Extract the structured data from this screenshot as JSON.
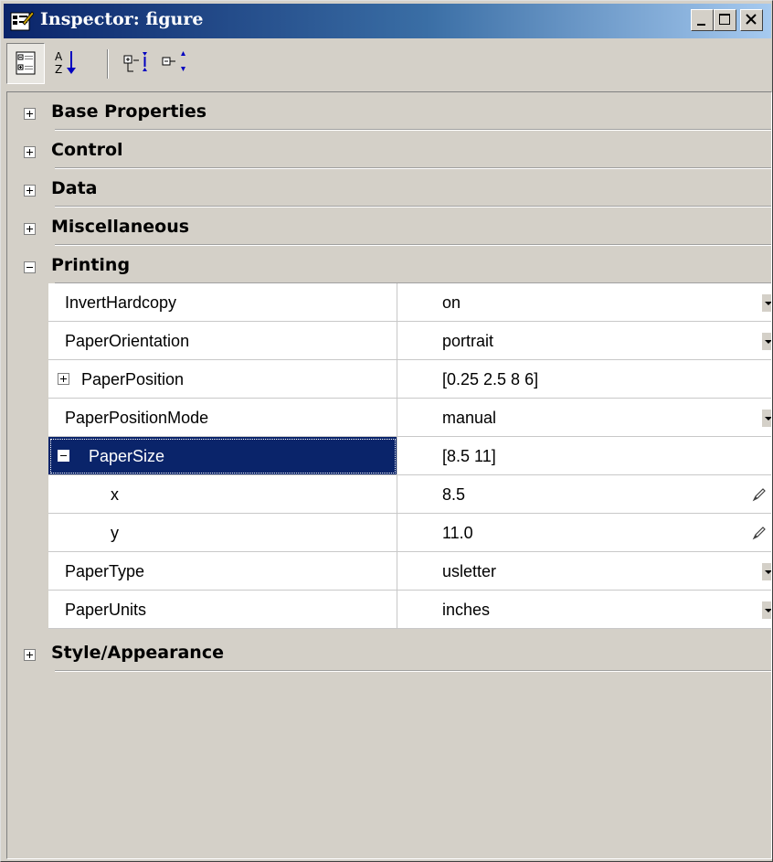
{
  "window": {
    "title": "Inspector: figure"
  },
  "toolbar": {
    "buttons": [
      "categorized-view",
      "alphabetical-sort",
      "expand-all",
      "collapse-all"
    ]
  },
  "categories": [
    {
      "label": "Base Properties",
      "expanded": false
    },
    {
      "label": "Control",
      "expanded": false
    },
    {
      "label": "Data",
      "expanded": false
    },
    {
      "label": "Miscellaneous",
      "expanded": false
    },
    {
      "label": "Printing",
      "expanded": true
    },
    {
      "label": "Style/Appearance",
      "expanded": false
    }
  ],
  "properties": [
    {
      "name": "InvertHardcopy",
      "value": "on",
      "editor": "dropdown"
    },
    {
      "name": "PaperOrientation",
      "value": "portrait",
      "editor": "dropdown"
    },
    {
      "name": "PaperPosition",
      "value": "[0.25 2.5 8 6]",
      "editor": "none",
      "expander": "plus"
    },
    {
      "name": "PaperPositionMode",
      "value": "manual",
      "editor": "dropdown"
    },
    {
      "name": "PaperSize",
      "value": "[8.5 11]",
      "editor": "none",
      "expander": "minus",
      "selected": true
    },
    {
      "name": "x",
      "value": "8.5",
      "editor": "pencil",
      "child": true
    },
    {
      "name": "y",
      "value": "11.0",
      "editor": "pencil",
      "child": true
    },
    {
      "name": "PaperType",
      "value": "usletter",
      "editor": "dropdown"
    },
    {
      "name": "PaperUnits",
      "value": "inches",
      "editor": "dropdown"
    }
  ],
  "colors": {
    "title_start": "#0a246a",
    "title_end": "#a6caf0",
    "selection": "#0a246a",
    "face": "#d4d0c8"
  }
}
